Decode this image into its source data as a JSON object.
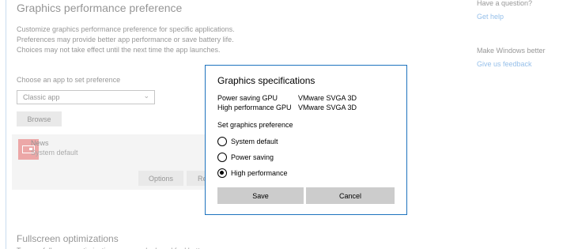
{
  "page": {
    "title": "Graphics performance preference",
    "description": "Customize graphics performance preference for specific applications. Preferences may provide better app performance or save battery life. Choices may not take effect until the next time the app launches.",
    "choose_label": "Choose an app to set preference",
    "app_type_select": {
      "value": "Classic app"
    },
    "browse_label": "Browse",
    "app": {
      "name": "News",
      "sub": "System default",
      "icon": "news-app-icon"
    },
    "options_label": "Options",
    "remove_label": "Remove",
    "fullscreen_title": "Fullscreen optimizations",
    "fullscreen_sub": "Turn on fullscreen optimizations so apps look and feel better"
  },
  "sidebar": {
    "question": "Have a question?",
    "help_link": "Get help",
    "better": "Make Windows better",
    "feedback_link": "Give us feedback"
  },
  "dialog": {
    "title": "Graphics specifications",
    "specs": [
      {
        "label": "Power saving GPU",
        "value": "VMware SVGA 3D"
      },
      {
        "label": "High performance GPU",
        "value": "VMware SVGA 3D"
      }
    ],
    "set_label": "Set graphics preference",
    "options": [
      {
        "label": "System default",
        "checked": false
      },
      {
        "label": "Power saving",
        "checked": false
      },
      {
        "label": "High performance",
        "checked": true
      }
    ],
    "save_label": "Save",
    "cancel_label": "Cancel"
  },
  "colors": {
    "accent": "#1e73be",
    "link": "#0066cc",
    "app_icon": "#d32f2f",
    "button": "#cccccc"
  }
}
